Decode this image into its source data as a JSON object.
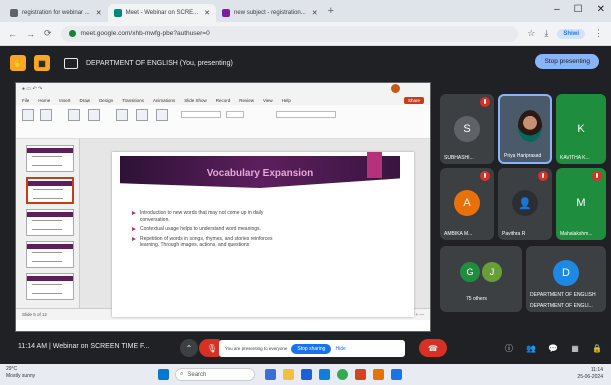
{
  "browser": {
    "tabs": [
      {
        "label": "registration for webinar ...",
        "color": "#5f6368",
        "active": false
      },
      {
        "label": "Meet - Webinar on SCRE...",
        "color": "#00897b",
        "active": true
      },
      {
        "label": "new subject - registration...",
        "color": "#7b1fa2",
        "active": false
      }
    ],
    "url": "meet.google.com/xhb-mwfg-pbe?authuser=0",
    "profile": "Shiwi"
  },
  "meet": {
    "presenting_label": "DEPARTMENT OF ENGLISH (You, presenting)",
    "stop_presenting": "Stop presenting",
    "time": "11:14 AM",
    "meeting_title": "Webinar on SCREEN TIME F...",
    "banner_text": "You are presenting to everyone",
    "banner_stop": "Stop sharing",
    "banner_hide": "Hide"
  },
  "ppt": {
    "menu": [
      "File",
      "Home",
      "Insert",
      "Draw",
      "Design",
      "Transitions",
      "Animations",
      "Slide Show",
      "Record",
      "Review",
      "View",
      "Help"
    ],
    "share_label": "Share",
    "slide_title": "Vocabulary Expansion",
    "bullets": [
      "Introduction to new words that may not come up in daily conversation.",
      "Contextual usage helps to understand word meanings.",
      "Repetition of words in songs, rhymes, and stories reinforces learning. Through images, actions, and questions"
    ],
    "status_left": "Slide 5 of 12",
    "status_right": "Notes"
  },
  "participants": [
    {
      "initial": "S",
      "name": "SUBHASHI...",
      "color": "#5f6368"
    },
    {
      "initial": "",
      "name": "Priya Hariprasad",
      "color": "#4a5a6a"
    },
    {
      "initial": "K",
      "name": "KAVITHA K...",
      "color": "#1e8e3e"
    },
    {
      "initial": "A",
      "name": "AMBIKA M...",
      "color": "#e8710a"
    },
    {
      "initial": "",
      "name": "Pavithra R",
      "color": "#3c4043"
    },
    {
      "initial": "M",
      "name": "Mahalakshm...",
      "color": "#1e8e3e"
    },
    {
      "initial": "G",
      "name": "",
      "color": "#1e8e3e"
    },
    {
      "initial": "J",
      "name": "",
      "color": "#689f38"
    },
    {
      "initial": "D",
      "name": "DEPARTMENT OF ENGLISH",
      "color": "#1e88e5"
    }
  ],
  "others_label": "75 others",
  "department_tile_name": "DEPARTMENT OF ENGLI...",
  "taskbar": {
    "weather_temp": "29°C",
    "weather_desc": "Mostly sunny",
    "search_placeholder": "Search",
    "clock_time": "11:14",
    "clock_date": "25-06-2024"
  }
}
